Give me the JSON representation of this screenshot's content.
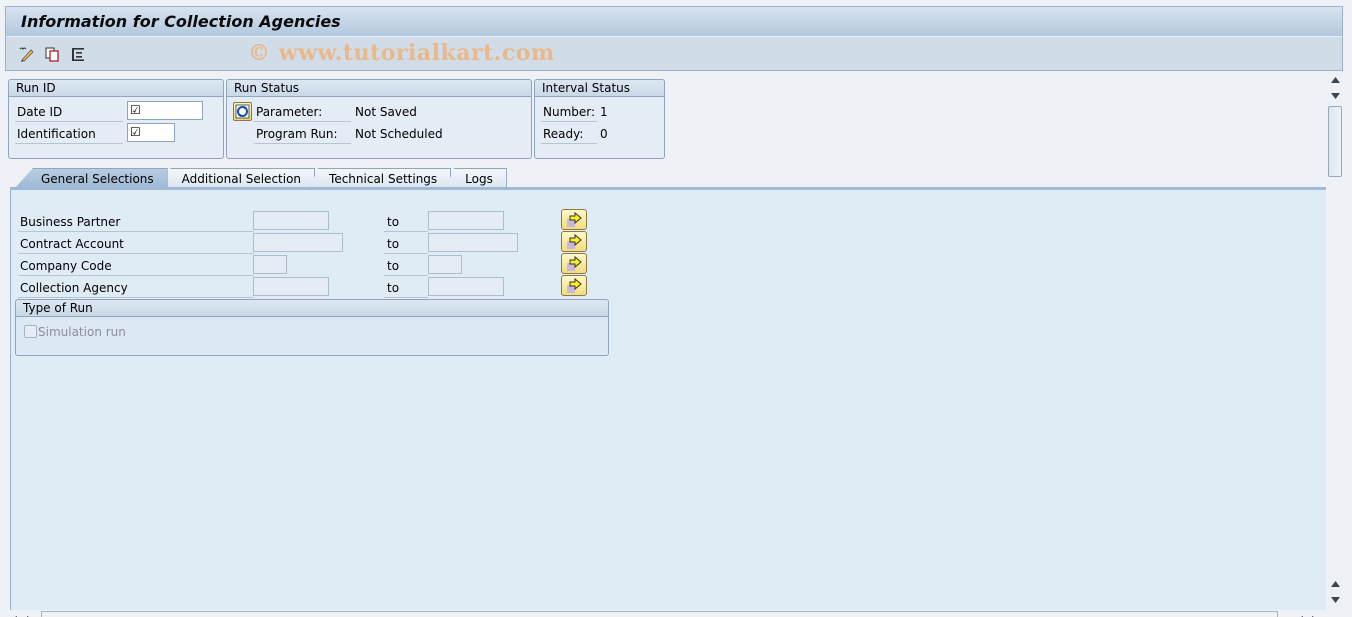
{
  "window": {
    "title": "Information for Collection Agencies",
    "watermark": "© www.tutorialkart.com"
  },
  "toolbar": {
    "buttons": [
      {
        "icon": "edit-pencil-icon",
        "label": "Change"
      },
      {
        "icon": "copy-icon",
        "label": "Copy"
      },
      {
        "icon": "list-icon",
        "label": "Display"
      }
    ]
  },
  "run_id": {
    "title": "Run ID",
    "date_id_label": "Date ID",
    "date_id_value": "☑",
    "identification_label": "Identification",
    "identification_value": "☑"
  },
  "run_status": {
    "title": "Run Status",
    "parameter_label": "Parameter:",
    "parameter_value": "Not Saved",
    "program_run_label": "Program Run:",
    "program_run_value": "Not Scheduled",
    "refresh_icon": "refresh-icon"
  },
  "interval_status": {
    "title": "Interval Status",
    "number_label": "Number:",
    "number_value": "1",
    "ready_label": "Ready:",
    "ready_value": "0"
  },
  "tabs": [
    {
      "label": "General Selections",
      "active": true
    },
    {
      "label": "Additional Selection",
      "active": false
    },
    {
      "label": "Technical Settings",
      "active": false
    },
    {
      "label": "Logs",
      "active": false
    }
  ],
  "selections": {
    "to_label": "to",
    "rows": [
      {
        "label": "Business Partner",
        "from": "",
        "to": ""
      },
      {
        "label": "Contract Account",
        "from": "",
        "to": ""
      },
      {
        "label": "Company Code",
        "from": "",
        "to": ""
      },
      {
        "label": "Collection Agency",
        "from": "",
        "to": ""
      }
    ]
  },
  "type_of_run": {
    "title": "Type of Run",
    "simulation_label": "Simulation run",
    "simulation_checked": false
  },
  "colors": {
    "title_bar": "#b3c8de",
    "toolbar": "#d0dce7",
    "panel": "#dfebf5",
    "active_tab": "#9ebad6",
    "watermark": "#eab98a"
  }
}
